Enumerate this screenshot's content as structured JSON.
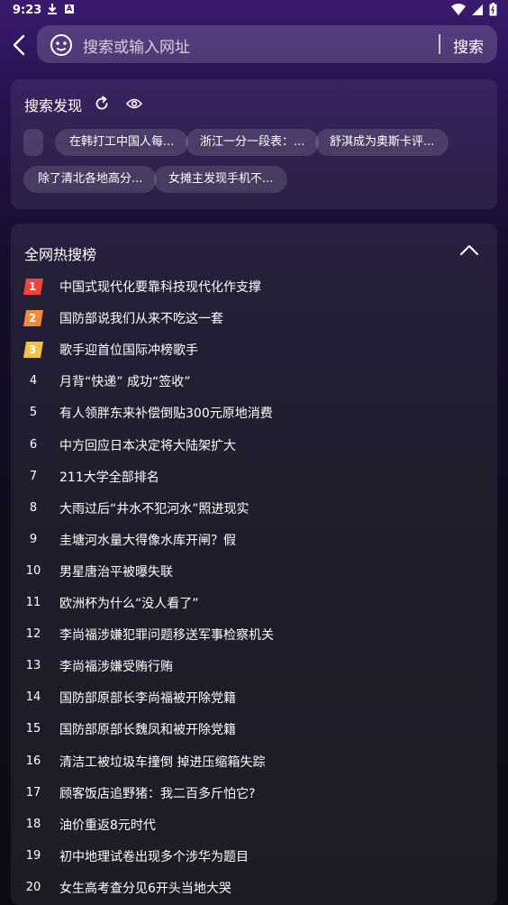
{
  "status_bar": {
    "time": "9:23",
    "a_icon": "A"
  },
  "search": {
    "placeholder": "搜索或输入网址",
    "button_label": "搜索"
  },
  "discover": {
    "title": "搜索发现",
    "chips": [
      "",
      "在韩打工中国人每...",
      "浙江一分一段表：...",
      "舒淇成为奥斯卡评...",
      "除了清北各地高分...",
      "女摊主发现手机不..."
    ]
  },
  "hot": {
    "title": "全网热搜榜",
    "badge_colors": [
      "#f0443c",
      "#f38a3a",
      "#f5c242"
    ],
    "items": [
      {
        "rank": "1",
        "text": "中国式现代化要靠科技现代化作支撑"
      },
      {
        "rank": "2",
        "text": "国防部说我们从来不吃这一套"
      },
      {
        "rank": "3",
        "text": "歌手迎首位国际冲榜歌手"
      },
      {
        "rank": "4",
        "text": "月背“快递” 成功“签收”"
      },
      {
        "rank": "5",
        "text": "有人领胖东来补偿倒贴300元原地消费"
      },
      {
        "rank": "6",
        "text": "中方回应日本决定将大陆架扩大"
      },
      {
        "rank": "7",
        "text": "211大学全部排名"
      },
      {
        "rank": "8",
        "text": "大雨过后“井水不犯河水”照进现实"
      },
      {
        "rank": "9",
        "text": "圭塘河水量大得像水库开闸？假"
      },
      {
        "rank": "10",
        "text": "男星唐治平被曝失联"
      },
      {
        "rank": "11",
        "text": "欧洲杯为什么“没人看了”"
      },
      {
        "rank": "12",
        "text": "李尚福涉嫌犯罪问题移送军事检察机关"
      },
      {
        "rank": "13",
        "text": "李尚福涉嫌受贿行贿"
      },
      {
        "rank": "14",
        "text": "国防部原部长李尚福被开除党籍"
      },
      {
        "rank": "15",
        "text": "国防部原部长魏凤和被开除党籍"
      },
      {
        "rank": "16",
        "text": "清洁工被垃圾车撞倒 掉进压缩箱失踪"
      },
      {
        "rank": "17",
        "text": "顾客饭店追野猪：我二百多斤怕它?"
      },
      {
        "rank": "18",
        "text": "油价重返8元时代"
      },
      {
        "rank": "19",
        "text": "初中地理试卷出现多个涉华为题目"
      },
      {
        "rank": "20",
        "text": "女生高考查分见6开头当地大哭"
      }
    ]
  }
}
